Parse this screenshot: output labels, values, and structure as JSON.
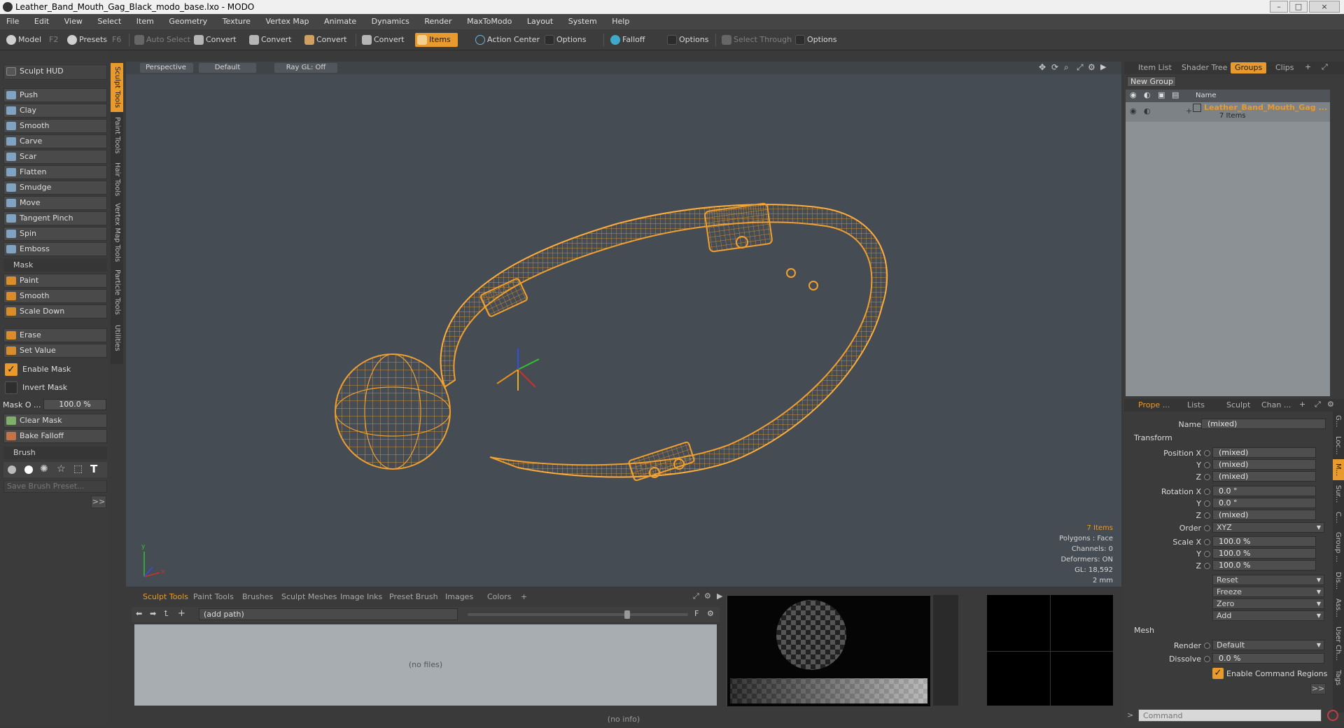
{
  "window": {
    "title": "Leather_Band_Mouth_Gag_Black_modo_base.lxo - MODO",
    "min": "–",
    "max": "□",
    "close": "×"
  },
  "menu": [
    "File",
    "Edit",
    "View",
    "Select",
    "Item",
    "Geometry",
    "Texture",
    "Vertex Map",
    "Animate",
    "Dynamics",
    "Render",
    "MaxToModo",
    "Layout",
    "System",
    "Help"
  ],
  "toolbar": {
    "model": "Model",
    "model_key": "F2",
    "presets": "Presets",
    "presets_key": "F6",
    "auto_select": "Auto Select",
    "convert1": "Convert",
    "convert2": "Convert",
    "convert3": "Convert",
    "convert4": "Convert",
    "items": "Items",
    "action_center": "Action Center",
    "options1": "Options",
    "falloff": "Falloff",
    "options2": "Options",
    "select_through": "Select Through",
    "options3": "Options"
  },
  "left": {
    "sculpt_hud": "Sculpt HUD",
    "tools": [
      "Push",
      "Clay",
      "Smooth",
      "Carve",
      "Scar",
      "Flatten",
      "Smudge",
      "Move",
      "Tangent Pinch",
      "Spin",
      "Emboss"
    ],
    "mask_header": "Mask",
    "mask_tools": [
      "Paint",
      "Smooth",
      "Scale Down"
    ],
    "erase": "Erase",
    "set_value": "Set Value",
    "enable_mask": "Enable Mask",
    "invert_mask": "Invert Mask",
    "mask_opacity_label": "Mask O ...",
    "mask_opacity_value": "100.0 %",
    "clear_mask": "Clear Mask",
    "bake_falloff": "Bake Falloff",
    "brush_header": "Brush",
    "save_brush": "Save Brush Preset...",
    "more": ">>"
  },
  "vtabs": [
    "Sculpt Tools",
    "Paint Tools",
    "Hair Tools",
    "Vertex Map Tools",
    "Particle Tools",
    "Utilities"
  ],
  "viewport": {
    "perspective": "Perspective",
    "default": "Default",
    "raygl": "Ray GL: Off",
    "info_items": "7 Items",
    "info_polygons": "Polygons : Face",
    "info_channels": "Channels: 0",
    "info_deformers": "Deformers: ON",
    "info_gl": "GL: 18,592",
    "info_scale": "2 mm",
    "axis_x": "x",
    "axis_y": "y"
  },
  "bottom": {
    "tabs": [
      "Sculpt Tools",
      "Paint Tools",
      "Brushes",
      "Sculpt Meshes",
      "Image Inks",
      "Preset Brush",
      "Images",
      "Colors"
    ],
    "add_tab": "+",
    "path": "(add path)",
    "no_files": "(no files)",
    "f_label": "F"
  },
  "right": {
    "tabs": [
      "Item List",
      "Shader Tree",
      "Groups",
      "Clips"
    ],
    "new_group": "New Group",
    "col_name": "Name",
    "group_name": "Leather_Band_Mouth_Gag ...",
    "group_count": "7 Items",
    "prop_tabs": [
      "Prope ...",
      "Lists",
      "Sculpt",
      "Chan ..."
    ],
    "name_label": "Name",
    "name_value": "(mixed)",
    "transform": "Transform",
    "pos_x_label": "Position X",
    "pos_x": "(mixed)",
    "pos_y_label": "Y",
    "pos_y": "(mixed)",
    "pos_z_label": "Z",
    "pos_z": "(mixed)",
    "rot_x_label": "Rotation X",
    "rot_x": "0.0 °",
    "rot_y_label": "Y",
    "rot_y": "0.0 °",
    "rot_z_label": "Z",
    "rot_z": "(mixed)",
    "order_label": "Order",
    "order": "XYZ",
    "scale_x_label": "Scale X",
    "scale_x": "100.0 %",
    "scale_y_label": "Y",
    "scale_y": "100.0 %",
    "scale_z_label": "Z",
    "scale_z": "100.0 %",
    "reset": "Reset",
    "freeze": "Freeze",
    "zero": "Zero",
    "add": "Add",
    "mesh": "Mesh",
    "render_label": "Render",
    "render": "Default",
    "dissolve_label": "Dissolve",
    "dissolve": "0.0 %",
    "enable_cmd_regions": "Enable Command Regions",
    "more": ">>",
    "side_tabs": [
      "G...",
      "Loc...",
      "M...",
      "Sur...",
      "C...",
      "Group ...",
      "Dis...",
      "Ass...",
      "User Ch...",
      "Tags"
    ]
  },
  "command": {
    "placeholder": "Command",
    "prompt": ">"
  },
  "status": "(no info)",
  "colors": {
    "accent": "#e89a2c",
    "wire": "#f0a030",
    "viewport_bg": "#464c53"
  }
}
